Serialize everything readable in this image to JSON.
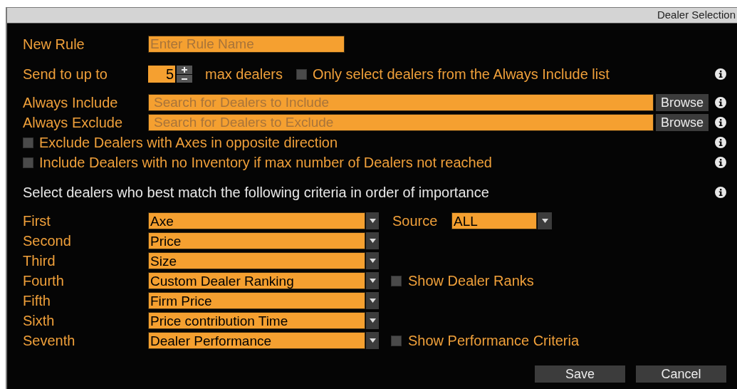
{
  "window": {
    "title": "Dealer Selection"
  },
  "new_rule": {
    "label": "New Rule",
    "placeholder": "Enter Rule Name"
  },
  "send_to": {
    "label": "Send to up to",
    "value": "5",
    "unit": "max dealers",
    "only_always_include": {
      "label": "Only select dealers from the Always Include list",
      "checked": false
    }
  },
  "dealer_lists": [
    {
      "label": "Always Include",
      "placeholder": "Search for Dealers to Include",
      "button": "Browse"
    },
    {
      "label": "Always Exclude",
      "placeholder": "Search for Dealers to Exclude",
      "button": "Browse"
    }
  ],
  "options": [
    {
      "label": "Exclude Dealers with Axes in opposite direction",
      "checked": false
    },
    {
      "label": "Include Dealers with no Inventory if max number of Dealers not reached",
      "checked": false
    }
  ],
  "criteria_heading": "Select dealers who best match the following criteria in order of importance",
  "criteria": [
    {
      "label": "First",
      "value": "Axe",
      "extra": {
        "kind": "source",
        "label": "Source",
        "value": "ALL"
      }
    },
    {
      "label": "Second",
      "value": "Price"
    },
    {
      "label": "Third",
      "value": "Size"
    },
    {
      "label": "Fourth",
      "value": "Custom Dealer Ranking",
      "extra": {
        "kind": "checkbox",
        "label": "Show Dealer Ranks",
        "checked": false
      }
    },
    {
      "label": "Fifth",
      "value": "Firm Price"
    },
    {
      "label": "Sixth",
      "value": "Price contribution Time"
    },
    {
      "label": "Seventh",
      "value": "Dealer Performance",
      "extra": {
        "kind": "checkbox",
        "label": "Show Performance Criteria",
        "checked": false
      }
    }
  ],
  "buttons": [
    {
      "label": "Save"
    },
    {
      "label": "Cancel"
    }
  ]
}
